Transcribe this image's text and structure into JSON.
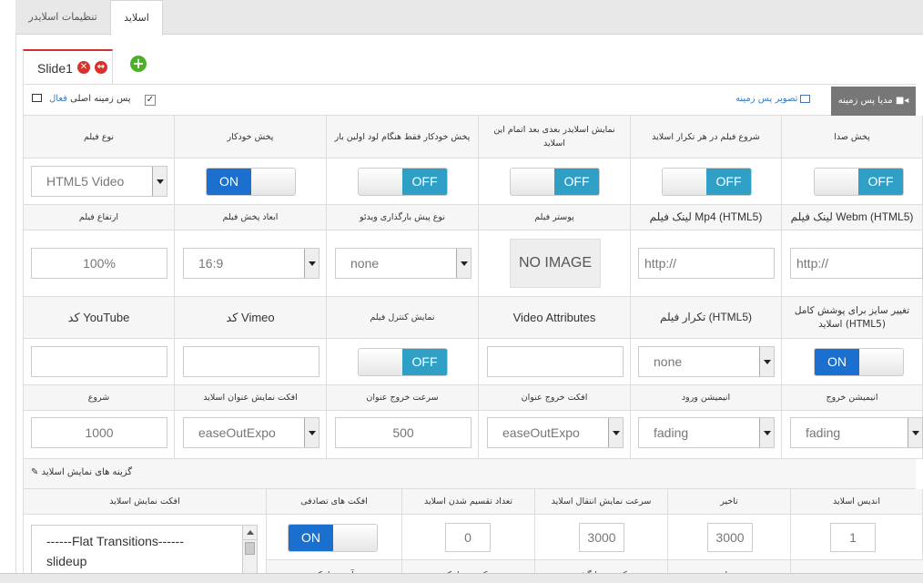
{
  "tabs": {
    "settings": "تنظیمات اسلایدر",
    "slides": "اسلاید"
  },
  "slide_tab": {
    "label": "Slide1"
  },
  "bg": {
    "media_label": "مدیا پس زمینه",
    "image_label": "تصویر پس زمینه",
    "main_bg_label": "پس زمینه اصلی",
    "active_label": "فعال",
    "checked": "✓"
  },
  "row1": {
    "headers": [
      "پخش صدا",
      "شروع فیلم در هر تکرار اسلاید",
      "نمایش اسلایدر بعدی بعد اتمام این اسلاید",
      "پخش خودکار فقط هنگام لود اولین بار",
      "پخش خودکار",
      "نوع فیلم"
    ],
    "toggles": [
      "OFF",
      "OFF",
      "OFF",
      "OFF",
      "ON"
    ],
    "video_type": "HTML5 Video"
  },
  "row2": {
    "headers": [
      "لینک فیلم Webm (HTML5)",
      "لینک فیلم Mp4 (HTML5)",
      "پوستر فیلم",
      "نوع پیش بارگذاری ویدئو",
      "ابعاد پخش فیلم",
      "ارتفاع فیلم"
    ],
    "webm_placeholder": "http://",
    "mp4_placeholder": "http://",
    "poster": "NO IMAGE",
    "preload": "none",
    "aspect": "16:9",
    "height": "100%"
  },
  "row3": {
    "headers": [
      "تغییر سایز برای پوشش کامل اسلاید (HTML5)",
      "تکرار فیلم (HTML5)",
      "Video Attributes",
      "نمایش کنترل فیلم",
      "کد Vimeo",
      "کد YouTube"
    ],
    "fullsize": "ON",
    "loop": "none",
    "controls": "OFF"
  },
  "row4": {
    "headers": [
      "انیمیشن خروج",
      "انیمیشن ورود",
      "افکت خروج عنوان",
      "سرعت خروج عنوان",
      "افکت نمایش عنوان اسلاید",
      "شروع"
    ],
    "anim_out": "fading",
    "anim_in": "fading",
    "title_out_effect": "easeOutExpo",
    "title_out_speed": "500",
    "title_in_effect": "easeOutExpo",
    "start": "1000"
  },
  "options": {
    "label": "گزینه های نمایش اسلاید"
  },
  "row5": {
    "headers": [
      "اندیس اسلاید",
      "تاخیر",
      "سرعت نمایش انتقال اسلاید",
      "تعداد تقسیم شدن اسلاید",
      "افکت های تصادفی",
      "افکت نمایش اسلاید"
    ],
    "index": "1",
    "delay": "3000",
    "speed": "3000",
    "slots": "0",
    "random": "ON",
    "effects": [
      "------Flat Transitions------",
      "slideup"
    ]
  },
  "row6": {
    "headers": [
      "عنوان",
      "عکس بند انگشتی",
      "پیکربندی لینک",
      "آدرس لینک"
    ]
  }
}
